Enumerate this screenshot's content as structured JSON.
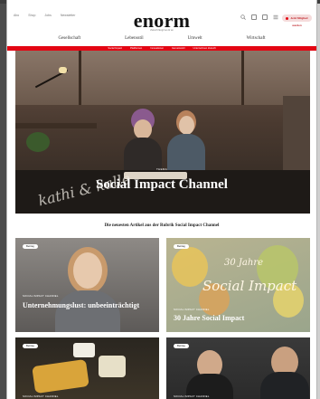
{
  "header": {
    "top_links": [
      "Abo",
      "Shop",
      "Jobs",
      "Newsletter"
    ],
    "logo": "enorm",
    "tagline": "Zukunft fängt bei dir an",
    "icons": [
      "search-icon",
      "user-icon",
      "bag-icon",
      "menu-icon"
    ],
    "subscribe_label": "Jetzt Mitglied werden"
  },
  "main_nav": [
    "Gesellschaft",
    "Lebensstil",
    "Umwelt",
    "Wirtschaft"
  ],
  "sub_nav": [
    "Social Impact",
    "Plattformen",
    "Innovationen",
    "Gemeinwohl",
    "Unternehmen Zukunft"
  ],
  "hero": {
    "kicker": "THEMA",
    "title": "Social Impact Channel",
    "sign_text": "kathi & kalle"
  },
  "section_title": "Die neuesten Artikel aus der Rubrik Social Impact Channel",
  "cards": [
    {
      "badge": "Beitrag",
      "kicker": "SOCIAL IMPACT CHANNEL",
      "title": "Unternehmungslust: unbeeinträchtigt"
    },
    {
      "badge": "Beitrag",
      "kicker": "SOCIAL IMPACT CHANNEL",
      "title": "30 Jahre Social Impact",
      "image_text": "30 Jahre Social Impact"
    },
    {
      "badge": "Beitrag",
      "kicker": "SOCIAL IMPACT CHANNEL"
    },
    {
      "badge": "Beitrag",
      "kicker": "SOCIAL IMPACT CHANNEL"
    }
  ],
  "colors": {
    "accent": "#e30613",
    "background": "#cfcfcf"
  }
}
